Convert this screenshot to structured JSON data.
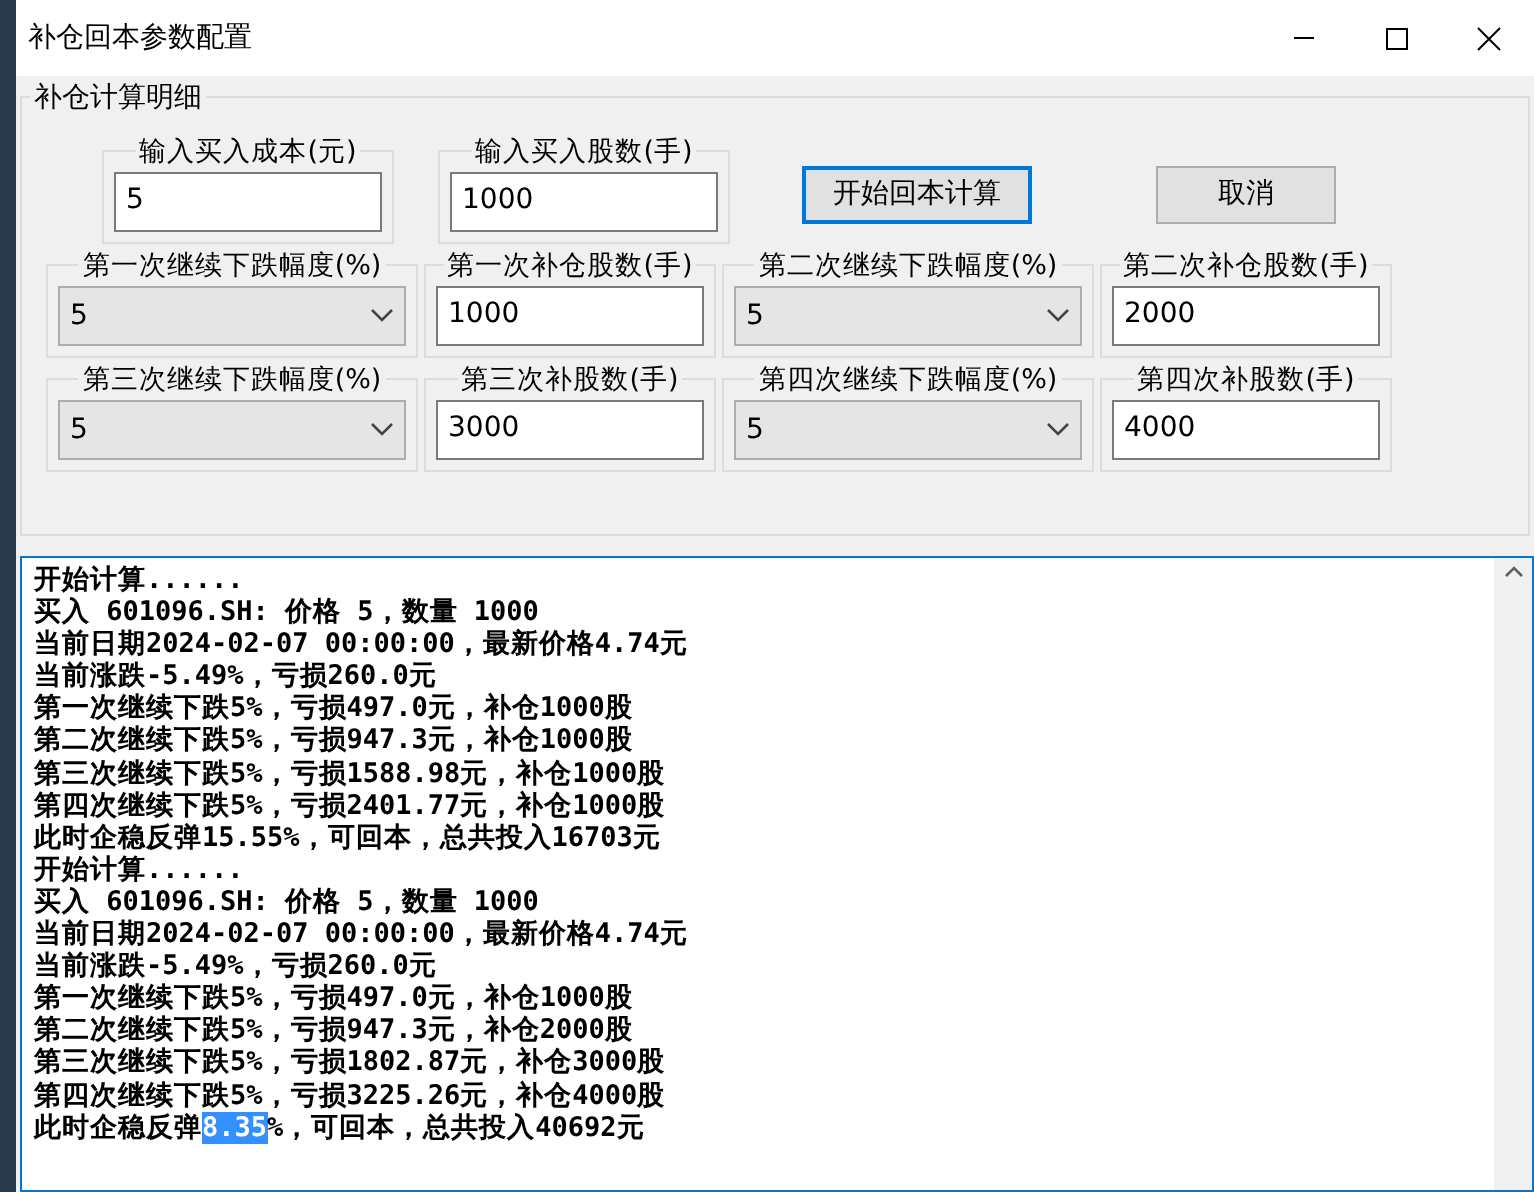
{
  "window": {
    "title": "补仓回本参数配置"
  },
  "group": {
    "title": "补仓计算明细"
  },
  "inputs": [
    {
      "label": "输入买入成本(元)",
      "value": "5"
    },
    {
      "label": "输入买入股数(手)",
      "value": "1000"
    }
  ],
  "buttons": [
    {
      "label": "开始回本计算",
      "focused": true
    },
    {
      "label": "取消",
      "focused": false
    }
  ],
  "params": [
    {
      "kind": "dropdown",
      "label": "第一次继续下跌幅度(%)",
      "value": "5"
    },
    {
      "kind": "text",
      "label": "第一次补仓股数(手)",
      "value": "1000"
    },
    {
      "kind": "dropdown",
      "label": "第二次继续下跌幅度(%)",
      "value": "5"
    },
    {
      "kind": "text",
      "label": "第二次补仓股数(手)",
      "value": "2000"
    },
    {
      "kind": "dropdown",
      "label": "第三次继续下跌幅度(%)",
      "value": "5"
    },
    {
      "kind": "text",
      "label": "第三次补股数(手)",
      "value": "3000"
    },
    {
      "kind": "dropdown",
      "label": "第四次继续下跌幅度(%)",
      "value": "5"
    },
    {
      "kind": "text",
      "label": "第四次补股数(手)",
      "value": "4000"
    }
  ],
  "log": {
    "lines": [
      [
        {
          "text": "开始计算......",
          "selected": false
        }
      ],
      [
        {
          "text": "买入 601096.SH: 价格 5，数量 1000",
          "selected": false
        }
      ],
      [
        {
          "text": "当前日期2024-02-07 00:00:00，最新价格4.74元",
          "selected": false
        }
      ],
      [
        {
          "text": "当前涨跌-5.49%，亏损260.0元",
          "selected": false
        }
      ],
      [
        {
          "text": "第一次继续下跌5%，亏损497.0元，补仓1000股",
          "selected": false
        }
      ],
      [
        {
          "text": "第二次继续下跌5%，亏损947.3元，补仓1000股",
          "selected": false
        }
      ],
      [
        {
          "text": "第三次继续下跌5%，亏损1588.98元，补仓1000股",
          "selected": false
        }
      ],
      [
        {
          "text": "第四次继续下跌5%，亏损2401.77元，补仓1000股",
          "selected": false
        }
      ],
      [
        {
          "text": "此时企稳反弹15.55%，可回本，总共投入16703元",
          "selected": false
        }
      ],
      [
        {
          "text": "开始计算......",
          "selected": false
        }
      ],
      [
        {
          "text": "买入 601096.SH: 价格 5，数量 1000",
          "selected": false
        }
      ],
      [
        {
          "text": "当前日期2024-02-07 00:00:00，最新价格4.74元",
          "selected": false
        }
      ],
      [
        {
          "text": "当前涨跌-5.49%，亏损260.0元",
          "selected": false
        }
      ],
      [
        {
          "text": "第一次继续下跌5%，亏损497.0元，补仓1000股",
          "selected": false
        }
      ],
      [
        {
          "text": "第二次继续下跌5%，亏损947.3元，补仓2000股",
          "selected": false
        }
      ],
      [
        {
          "text": "第三次继续下跌5%，亏损1802.87元，补仓3000股",
          "selected": false
        }
      ],
      [
        {
          "text": "第四次继续下跌5%，亏损3225.26元，补仓4000股",
          "selected": false
        }
      ],
      [
        {
          "text": "此时企稳反弹",
          "selected": false
        },
        {
          "text": "8.35",
          "selected": true
        },
        {
          "text": "%，可回本，总共投入40692元",
          "selected": false
        }
      ]
    ]
  }
}
